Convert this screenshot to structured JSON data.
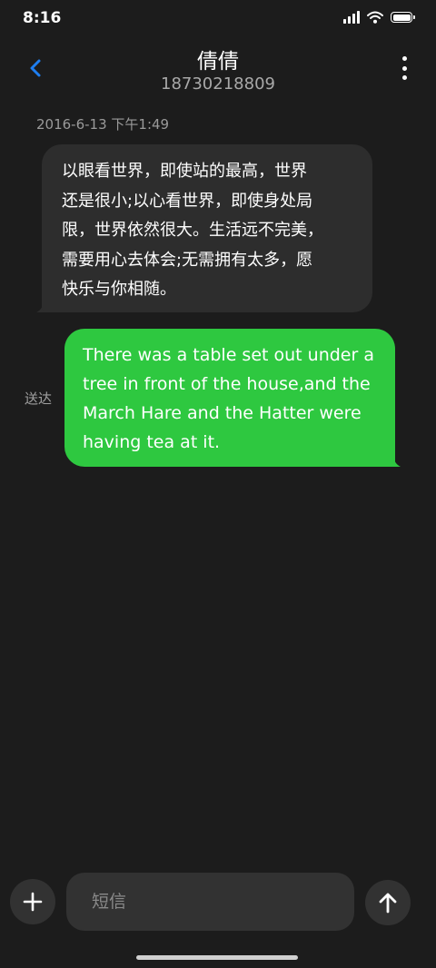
{
  "status_bar": {
    "time": "8:16"
  },
  "header": {
    "contact_name": "倩倩",
    "contact_number": "18730218809"
  },
  "conversation": {
    "timestamp": "2016-6-13 下午1:49",
    "messages": [
      {
        "direction": "incoming",
        "lines": [
          "以眼看世界，即使站的最高，世界",
          "还是很小;以心看世界，即使身处局",
          "限，世界依然很大。生活远不完美，",
          "需要用心去体会;无需拥有太多，愿",
          "快乐与你相随。"
        ]
      },
      {
        "direction": "outgoing",
        "lines": [
          "There was a table set out under a",
          "tree in front of the house,and the",
          "March Hare and the Hatter were",
          "having tea at it."
        ],
        "status": "送达"
      }
    ]
  },
  "input_bar": {
    "placeholder": "短信",
    "value": ""
  },
  "colors": {
    "background": "#1c1c1c",
    "incoming_bubble": "#2d2d2d",
    "outgoing_bubble": "#2ec840",
    "accent": "#1e7ef0",
    "control_bg": "#323232"
  },
  "icons": {
    "back": "chevron-left-icon",
    "more": "more-vertical-icon",
    "add": "plus-icon",
    "send": "arrow-up-icon"
  }
}
